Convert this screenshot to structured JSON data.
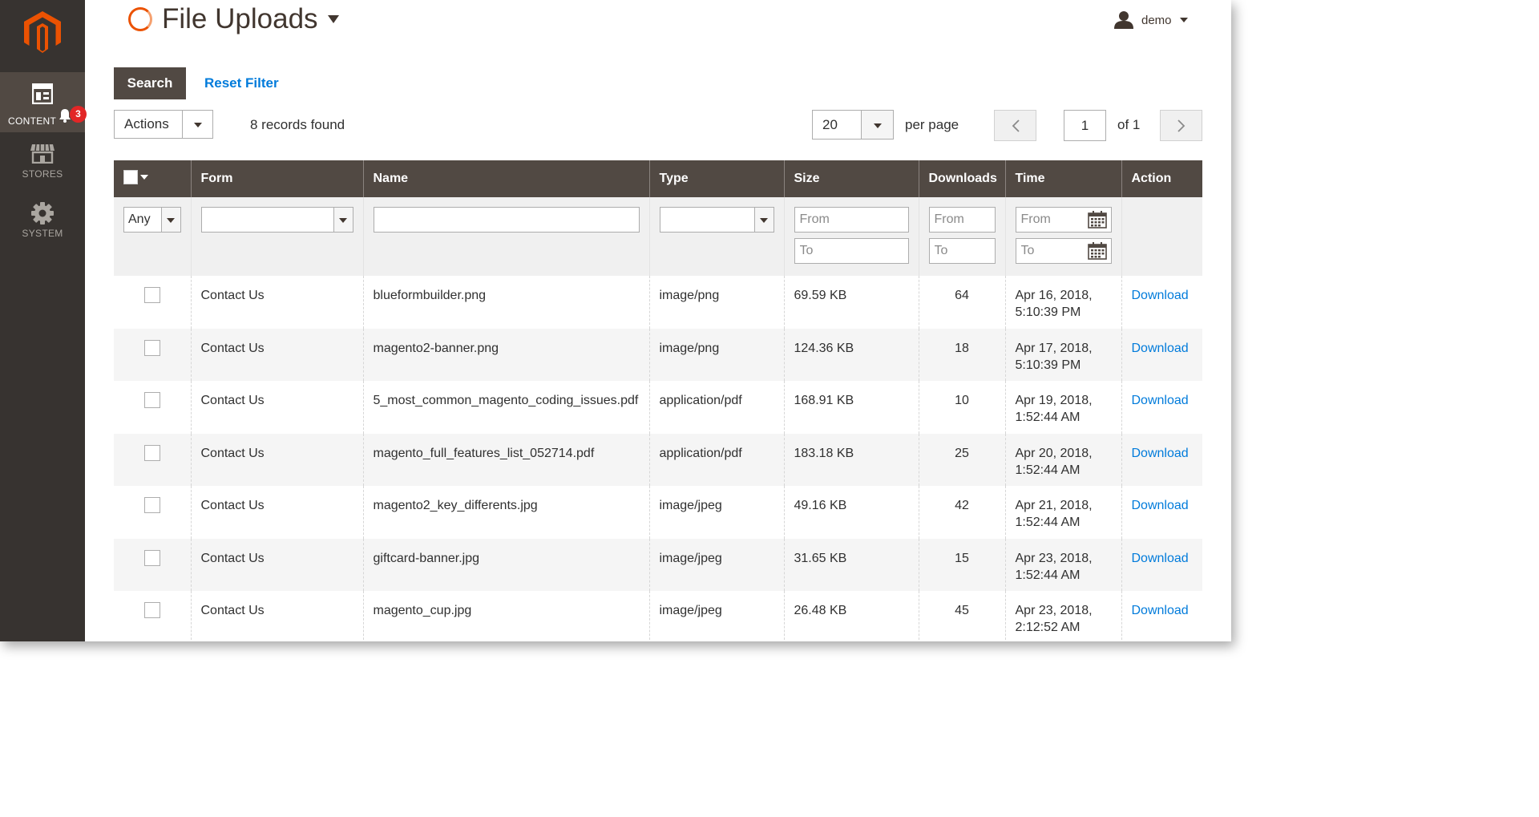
{
  "sidebar": {
    "items": [
      {
        "label": "CONTENT",
        "icon": "content-icon"
      },
      {
        "label": "STORES",
        "icon": "stores-icon"
      },
      {
        "label": "SYSTEM",
        "icon": "system-icon"
      }
    ],
    "notification_count": "3"
  },
  "header": {
    "title": "File Uploads",
    "user": "demo"
  },
  "filters": {
    "search_label": "Search",
    "reset_label": "Reset Filter"
  },
  "toolbar": {
    "actions_label": "Actions",
    "records_found": "8 records found",
    "per_page_value": "20",
    "per_page_label": "per page",
    "current_page": "1",
    "page_of": "of 1"
  },
  "grid": {
    "columns": [
      "Form",
      "Name",
      "Type",
      "Size",
      "Downloads",
      "Time",
      "Action"
    ],
    "filter": {
      "any": "Any",
      "from": "From",
      "to": "To"
    },
    "rows": [
      {
        "form": "Contact Us",
        "name": "blueformbuilder.png",
        "type": "image/png",
        "size": "69.59 KB",
        "downloads": "64",
        "time1": "Apr 16, 2018,",
        "time2": "5:10:39 PM",
        "action": "Download"
      },
      {
        "form": "Contact Us",
        "name": "magento2-banner.png",
        "type": "image/png",
        "size": "124.36 KB",
        "downloads": "18",
        "time1": "Apr 17, 2018,",
        "time2": "5:10:39 PM",
        "action": "Download"
      },
      {
        "form": "Contact Us",
        "name": "5_most_common_magento_coding_issues.pdf",
        "type": "application/pdf",
        "size": "168.91 KB",
        "downloads": "10",
        "time1": "Apr 19, 2018,",
        "time2": "1:52:44 AM",
        "action": "Download"
      },
      {
        "form": "Contact Us",
        "name": "magento_full_features_list_052714.pdf",
        "type": "application/pdf",
        "size": "183.18 KB",
        "downloads": "25",
        "time1": "Apr 20, 2018,",
        "time2": "1:52:44 AM",
        "action": "Download"
      },
      {
        "form": "Contact Us",
        "name": "magento2_key_differents.jpg",
        "type": "image/jpeg",
        "size": "49.16 KB",
        "downloads": "42",
        "time1": "Apr 21, 2018,",
        "time2": "1:52:44 AM",
        "action": "Download"
      },
      {
        "form": "Contact Us",
        "name": "giftcard-banner.jpg",
        "type": "image/jpeg",
        "size": "31.65 KB",
        "downloads": "15",
        "time1": "Apr 23, 2018,",
        "time2": "1:52:44 AM",
        "action": "Download"
      },
      {
        "form": "Contact Us",
        "name": "magento_cup.jpg",
        "type": "image/jpeg",
        "size": "26.48 KB",
        "downloads": "45",
        "time1": "Apr 23, 2018,",
        "time2": "2:12:52 AM",
        "action": "Download"
      }
    ]
  },
  "colors": {
    "sidebar_bg": "#373330",
    "sidebar_active": "#514943",
    "brand_orange": "#eb5202",
    "link_blue": "#007bdb",
    "header_bg": "#514943",
    "badge_red": "#e22626"
  }
}
